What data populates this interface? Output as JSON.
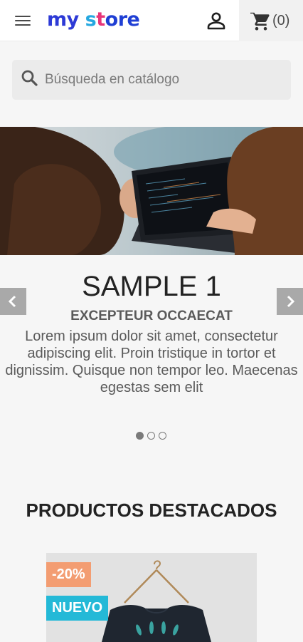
{
  "header": {
    "logo": {
      "part1": "my",
      "part2": "s",
      "part3": "t",
      "part4": "ore"
    },
    "menu_icon": "hamburger-icon",
    "user_icon": "user-icon",
    "cart_icon": "cart-icon",
    "cart_count": "(0)"
  },
  "search": {
    "placeholder": "Búsqueda en catálogo",
    "icon": "search-icon"
  },
  "carousel": {
    "title": "SAMPLE 1",
    "subtitle": "EXCEPTEUR OCCAECAT",
    "text": "Lorem ipsum dolor sit amet, consectetur adipiscing elit. Proin tristique in tortor et dignissim. Quisque non tempor leo. Maecenas egestas sem elit",
    "slide_count": 3,
    "active_slide": 1
  },
  "featured": {
    "title": "PRODUCTOS DESTACADOS",
    "products": [
      {
        "discount": "-20%",
        "flag": "NUEVO"
      }
    ]
  },
  "colors": {
    "accent": "#24b9d7",
    "discount": "#f39d72"
  }
}
